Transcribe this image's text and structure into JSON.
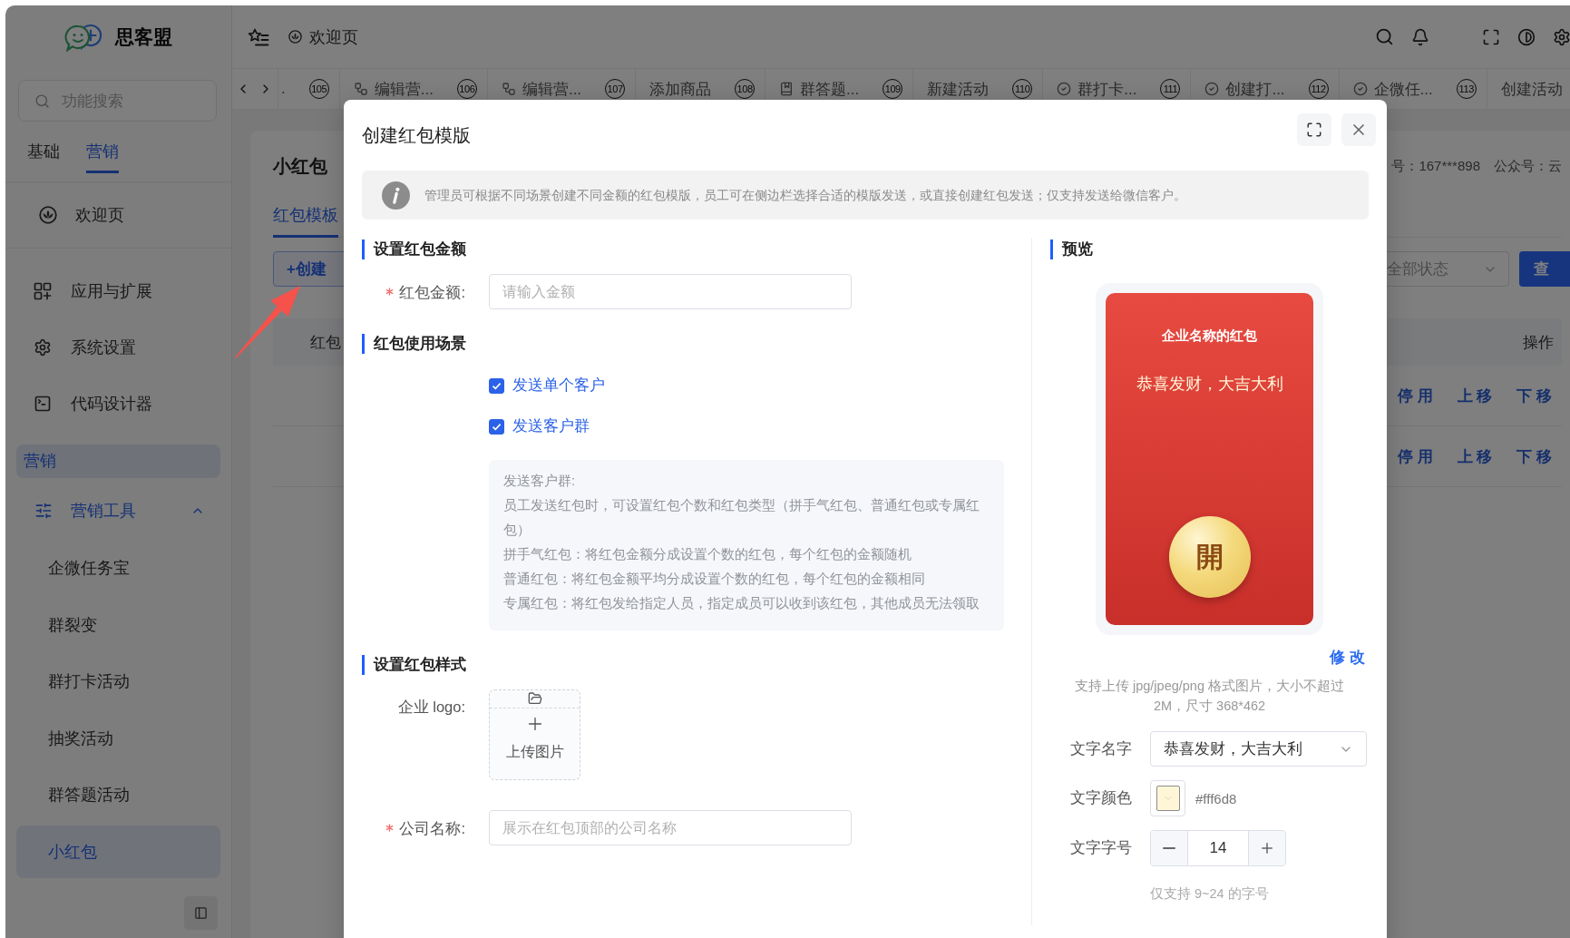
{
  "sidebar": {
    "logo": "思客盟",
    "search": {
      "placeholder": "功能搜索"
    },
    "tabs": [
      {
        "label": "基础",
        "selected": false
      },
      {
        "label": "营销",
        "selected": true
      }
    ],
    "home": {
      "label": "欢迎页",
      "selected": false
    },
    "menu": [
      {
        "label": "应用与扩展",
        "selected": false
      },
      {
        "label": "系统设置",
        "selected": false
      },
      {
        "label": "代码设计器",
        "selected": false
      }
    ],
    "category": "营销",
    "tree": [
      {
        "label": "营销工具",
        "expanded": true,
        "children": [
          {
            "label": "企微任务宝",
            "selected": false
          },
          {
            "label": "群裂变",
            "selected": false
          },
          {
            "label": "群打卡活动",
            "selected": false
          },
          {
            "label": "抽奖活动",
            "selected": false
          },
          {
            "label": "群答题活动",
            "selected": false
          },
          {
            "label": "小红包",
            "selected": true
          }
        ]
      }
    ]
  },
  "topbar": {
    "breadcrumb": "欢迎页"
  },
  "open_tabs": [
    {
      "label": ".",
      "number": "105",
      "selected": false
    },
    {
      "label": "编辑营...",
      "number": "106",
      "selected": false
    },
    {
      "label": "编辑营...",
      "number": "107",
      "selected": false
    },
    {
      "label": "添加商品",
      "number": "108",
      "selected": false
    },
    {
      "label": "群答题...",
      "number": "109",
      "selected": false
    },
    {
      "label": "新建活动",
      "number": "110",
      "selected": false
    },
    {
      "label": "群打卡...",
      "number": "111",
      "selected": false
    },
    {
      "label": "创建打...",
      "number": "112",
      "selected": false
    },
    {
      "label": "企微任...",
      "number": "113",
      "selected": false
    },
    {
      "label": "创建活动",
      "selected": false
    }
  ],
  "page": {
    "title": "小红包",
    "meta": [
      "号：167***898",
      "公众号：云"
    ],
    "tabs": [
      {
        "label": "红包模板",
        "selected": true
      }
    ],
    "create_button": "+创建",
    "status_select": "全部状态",
    "search_button": "查",
    "table": {
      "columns": [
        "红包",
        "操作"
      ],
      "rows": [
        {
          "actions": [
            "停 用",
            "上 移",
            "下 移"
          ]
        },
        {
          "actions": [
            "停 用",
            "上 移",
            "下 移"
          ]
        }
      ]
    }
  },
  "modal": {
    "title": "创建红包模版",
    "notice": "管理员可根据不同场景创建不同金额的红包模版，员工可在侧边栏选择合适的模版发送，或直接创建红包发送；仅支持发送给微信客户。",
    "amount": {
      "heading": "设置红包金额",
      "field": {
        "label": "红包金额:",
        "required": true,
        "placeholder": "请输入金额"
      }
    },
    "scene": {
      "heading": "红包使用场景",
      "options": [
        {
          "label": "发送单个客户",
          "checked": true
        },
        {
          "label": "发送客户群",
          "checked": true
        }
      ],
      "help": {
        "title": "发送客户群:",
        "lines": [
          "员工发送红包时，可设置红包个数和红包类型（拼手气红包、普通红包或专属红包）",
          "拼手气红包：将红包金额分成设置个数的红包，每个红包的金额随机",
          "普通红包：将红包金额平均分成设置个数的红包，每个红包的金额相同",
          "专属红包：将红包发给指定人员，指定成员可以收到该红包，其他成员无法领取"
        ]
      }
    },
    "style": {
      "heading": "设置红包样式",
      "logo": {
        "label": "企业 logo:",
        "upload": "上传图片"
      },
      "company": {
        "label": "公司名称:",
        "required": true,
        "placeholder": "展示在红包顶部的公司名称"
      }
    },
    "preview": {
      "heading": "预览",
      "envelope": {
        "company": "企业名称的红包",
        "greeting": "恭喜发财，大吉大利",
        "open": "開"
      },
      "edit": "修 改",
      "hint": "支持上传 jpg/jpeg/png 格式图片，大小不超过 2M，尺寸 368*462",
      "settings": [
        {
          "kind": "select",
          "label": "文字名字",
          "value": "恭喜发财，大吉大利"
        },
        {
          "kind": "color",
          "label": "文字颜色",
          "value": "#fff6d8",
          "color": "#fff6d8"
        },
        {
          "kind": "stepper",
          "label": "文字字号",
          "value": "14"
        }
      ],
      "note": "仅支持 9~24 的字号"
    }
  }
}
